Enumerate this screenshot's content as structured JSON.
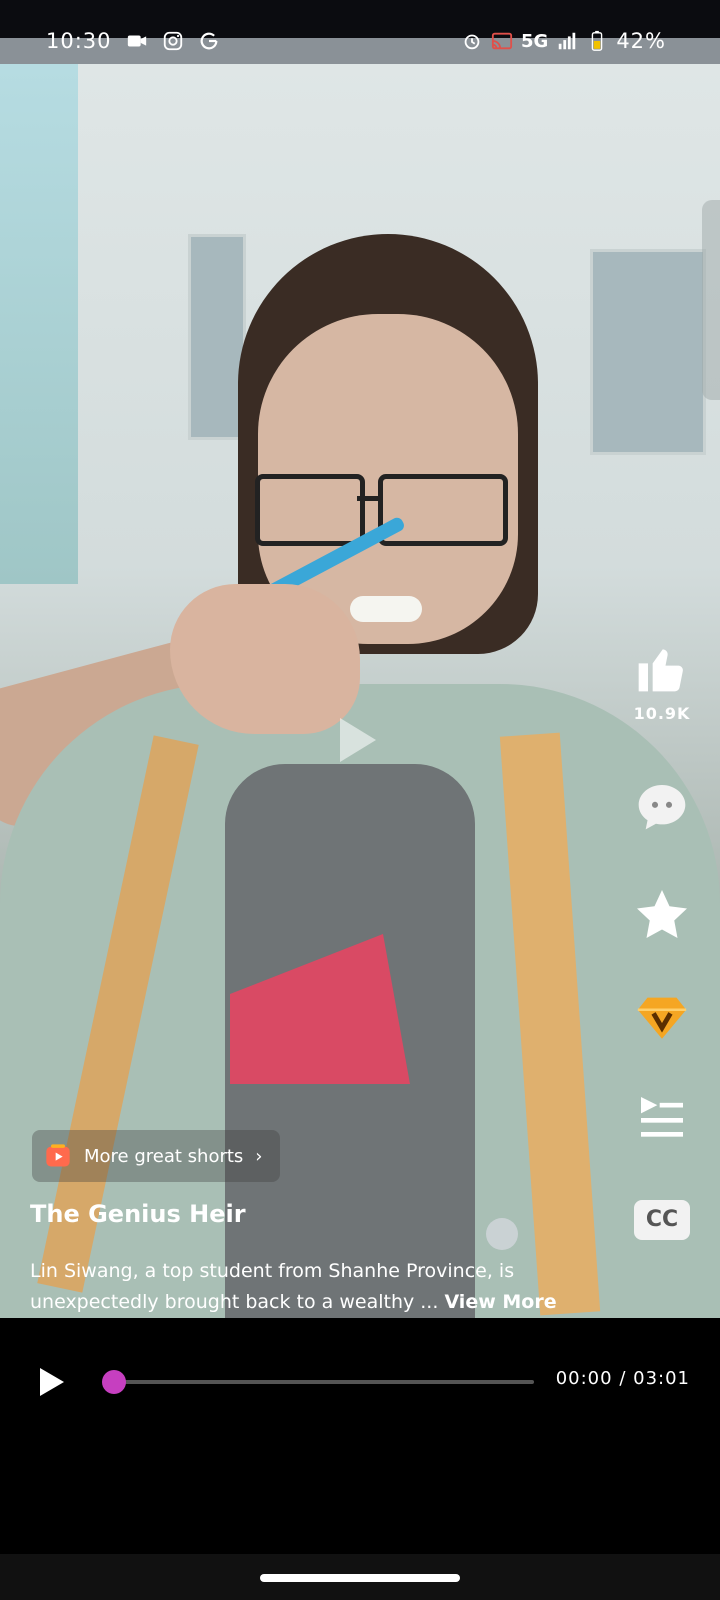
{
  "status_bar": {
    "time": "10:30",
    "network": "5G",
    "battery": "42%",
    "left_icons": [
      "video-record-icon",
      "instagram-icon",
      "google-icon"
    ],
    "right_icons": [
      "alarm-icon",
      "cast-icon",
      "signal-icon",
      "battery-icon"
    ]
  },
  "video": {
    "more_shorts_label": "More great shorts",
    "title": "The Genius Heir",
    "description": "Lin Siwang, a top student from Shanhe Province, is unexpectedly brought back to a wealthy ...",
    "view_more_label": "View More"
  },
  "actions": {
    "like_count": "10.9K",
    "cc_label": "CC"
  },
  "player": {
    "current_time": "00:00",
    "separator": "/",
    "duration": "03:01",
    "progress_fraction": 0.0
  },
  "colors": {
    "accent": "#c63fc0",
    "vip": "#f5a623"
  }
}
